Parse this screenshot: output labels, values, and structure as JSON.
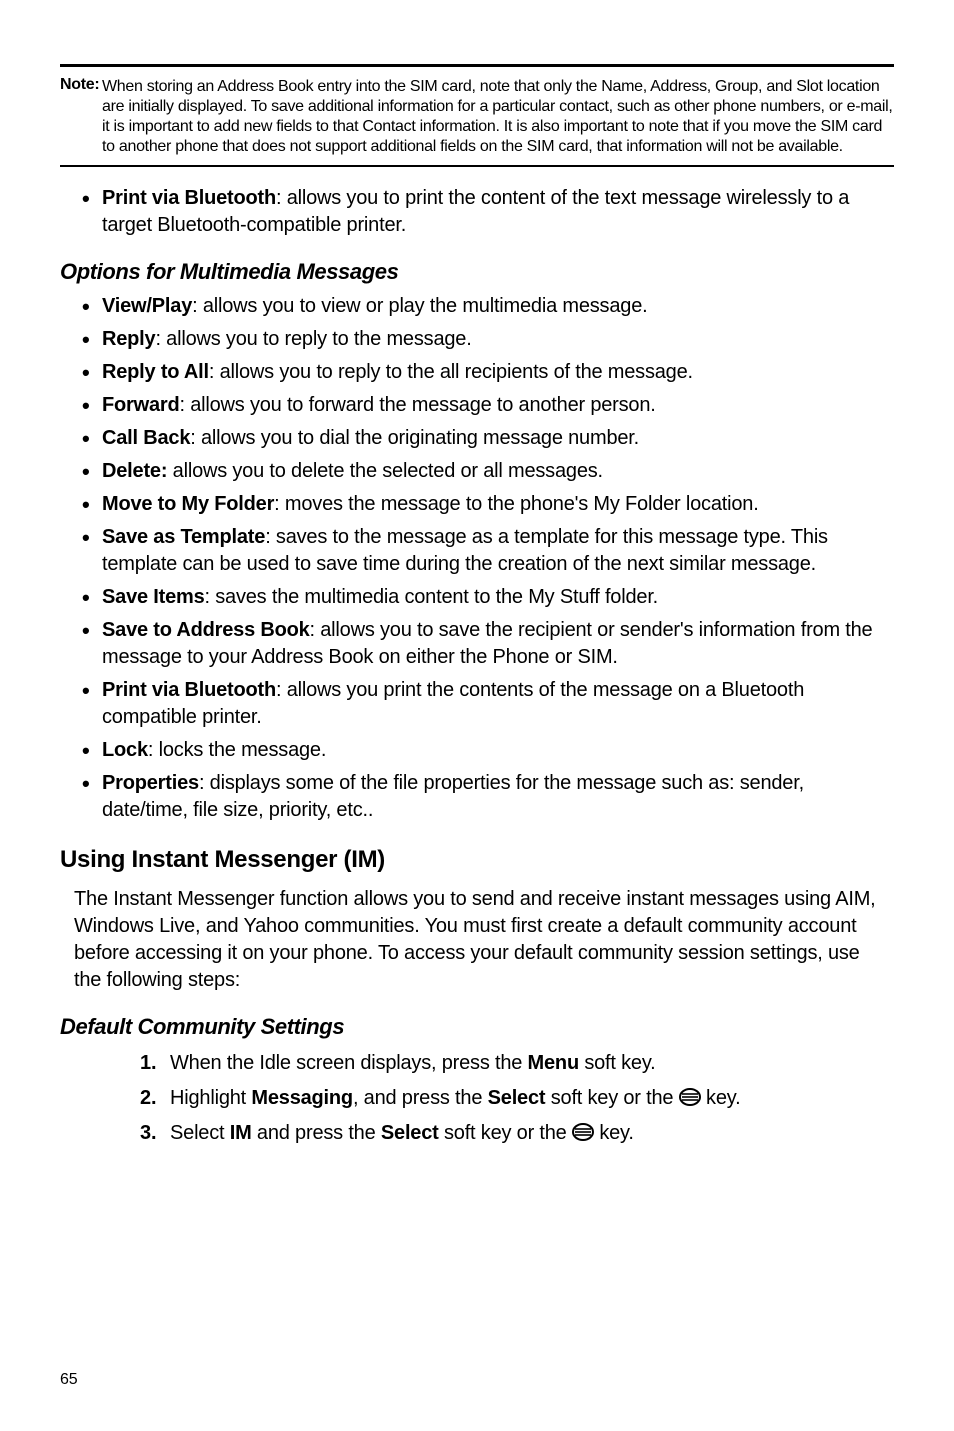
{
  "note": {
    "label": "Note:",
    "text": "When storing an Address Book entry into the SIM card, note that only the Name, Address, Group, and Slot location are initially displayed. To save additional information for a particular contact, such as other phone numbers, or e-mail, it is important to add new fields to that Contact information. It is also important to note that if you move the SIM card to another phone that does not support additional fields on the SIM card, that information will not be available."
  },
  "top_bullet": {
    "term": "Print via Bluetooth",
    "desc": ": allows you to print the content of the text message wirelessly to a target Bluetooth-compatible printer."
  },
  "heading_options": "Options for Multimedia Messages",
  "mm_bullets": [
    {
      "term": "View/Play",
      "desc": ": allows you to view or play the multimedia message."
    },
    {
      "term": "Reply",
      "desc": ": allows you to reply to the message."
    },
    {
      "term": "Reply to All",
      "desc": ": allows you to reply to the all recipients of the message."
    },
    {
      "term": "Forward",
      "desc": ": allows you to forward the message to another person."
    },
    {
      "term": "Call Back",
      "desc": ": allows you to dial the originating message number."
    },
    {
      "term": "Delete:",
      "desc": " allows you to delete the selected or all messages."
    },
    {
      "term": "Move to My Folder",
      "desc": ": moves the message to the phone's My Folder location."
    },
    {
      "term": "Save as Template",
      "desc": ": saves to the message as a template for this message type. This template can be used to save time during the creation of the next similar message."
    },
    {
      "term": "Save Items",
      "desc": ": saves the multimedia content to the My Stuff folder."
    },
    {
      "term": "Save to Address Book",
      "desc": ": allows you to save the recipient or sender's information from the message to your Address Book on either the Phone or SIM."
    },
    {
      "term": "Print via Bluetooth",
      "desc": ": allows you print the contents of the message on a Bluetooth compatible printer."
    },
    {
      "term": "Lock",
      "desc": ": locks the message."
    },
    {
      "term": "Properties",
      "desc": ": displays some of the file properties for the message such as: sender, date/time, file size, priority, etc.."
    }
  ],
  "heading_im": "Using Instant Messenger (IM)",
  "im_para": "The Instant Messenger function allows you to send and receive instant messages using AIM, Windows Live, and Yahoo communities. You must first create a default community account before accessing it on your phone. To access your default community session settings, use the following steps:",
  "heading_default": "Default Community Settings",
  "steps": {
    "s1_a": "When the Idle screen displays, press the ",
    "s1_b": "Menu",
    "s1_c": " soft key.",
    "s2_a": "Highlight ",
    "s2_b": "Messaging",
    "s2_c": ", and press the ",
    "s2_d": "Select",
    "s2_e": " soft key or the ",
    "s2_f": " key.",
    "s3_a": "Select ",
    "s3_b": "IM",
    "s3_c": " and press the ",
    "s3_d": "Select",
    "s3_e": " soft key or the ",
    "s3_f": " key."
  },
  "page_number": "65"
}
